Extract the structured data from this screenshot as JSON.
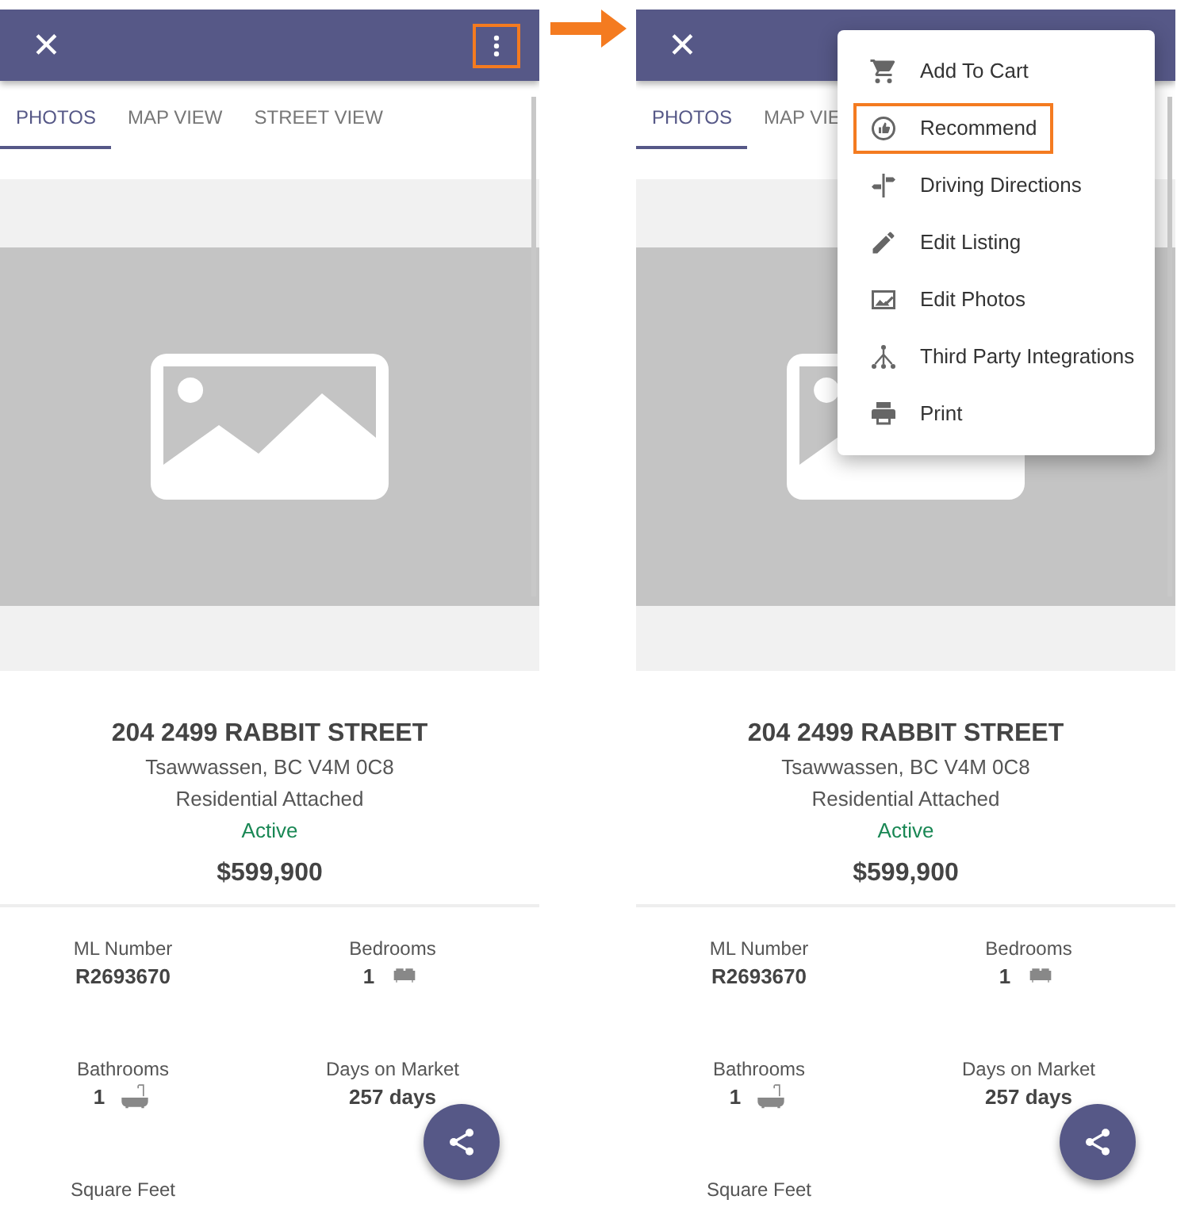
{
  "screens": [
    {
      "header": {
        "close": "✕",
        "more_highlighted": true
      },
      "tabs": [
        {
          "label": "PHOTOS",
          "selected": true
        },
        {
          "label": "MAP VIEW",
          "selected": false
        },
        {
          "label": "STREET VIEW",
          "selected": false
        }
      ],
      "listing": {
        "title": "204 2499 RABBIT STREET",
        "address": "Tsawwassen, BC V4M 0C8",
        "type": "Residential Attached",
        "status": "Active",
        "price": "$599,900"
      },
      "facts": [
        {
          "label": "ML Number",
          "value": "R2693670",
          "kind": "text"
        },
        {
          "label": "Bedrooms",
          "value": "1",
          "kind": "bed"
        },
        {
          "label": "Bathrooms",
          "value": "1",
          "kind": "bath"
        },
        {
          "label": "Days on Market",
          "value": "257 days",
          "kind": "text"
        },
        {
          "label": "Square Feet"
        }
      ]
    },
    {
      "header": {
        "close": "✕"
      },
      "tabs": [
        {
          "label": "PHOTOS",
          "selected": true
        },
        {
          "label": "MAP VIE",
          "selected": false
        }
      ],
      "listing": {
        "title": "204 2499 RABBIT STREET",
        "address": "Tsawwassen, BC V4M 0C8",
        "type": "Residential Attached",
        "status": "Active",
        "price": "$599,900"
      },
      "facts": [
        {
          "label": "ML Number",
          "value": "R2693670",
          "kind": "text"
        },
        {
          "label": "Bedrooms",
          "value": "1",
          "kind": "bed"
        },
        {
          "label": "Bathrooms",
          "value": "1",
          "kind": "bath"
        },
        {
          "label": "Days on Market",
          "value": "257 days",
          "kind": "text"
        },
        {
          "label": "Square Feet"
        }
      ],
      "menu": [
        {
          "label": "Add To Cart",
          "highlighted": false
        },
        {
          "label": "Recommend",
          "highlighted": true
        },
        {
          "label": "Driving Directions",
          "highlighted": false
        },
        {
          "label": "Edit Listing",
          "highlighted": false
        },
        {
          "label": "Edit Photos",
          "highlighted": false
        },
        {
          "label": "Third Party Integrations",
          "highlighted": false
        },
        {
          "label": "Print",
          "highlighted": false
        }
      ]
    }
  ]
}
